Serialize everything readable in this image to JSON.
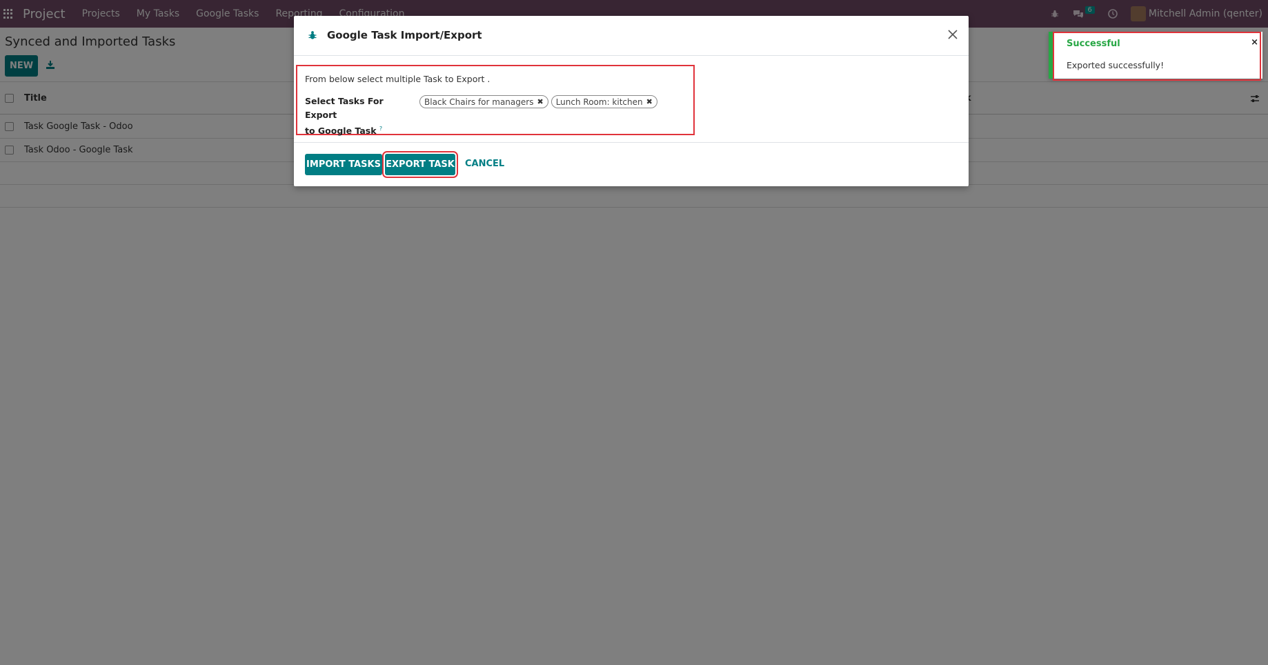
{
  "navbar": {
    "brand": "Project",
    "menu": [
      "Projects",
      "My Tasks",
      "Google Tasks",
      "Reporting",
      "Configuration"
    ],
    "chat_badge": "6",
    "user": "Mitchell Admin (qenter)"
  },
  "control_panel": {
    "title": "Synced and Imported Tasks",
    "new_label": "NEW"
  },
  "list": {
    "columns": [
      "Title",
      "k"
    ],
    "rows": [
      "Task Google Task - Odoo",
      "Task Odoo - Google Task"
    ]
  },
  "dialog": {
    "title": "Google Task Import/Export",
    "hint": "From below select multiple Task to Export .",
    "field_label_line1": "Select Tasks For Export",
    "field_label_line2": "to Google Task",
    "help_mark": "?",
    "tags": [
      "Black Chairs for managers",
      "Lunch Room: kitchen"
    ],
    "buttons": {
      "import": "IMPORT TASKS",
      "export": "EXPORT TASK",
      "cancel": "CANCEL"
    }
  },
  "toast": {
    "title": "Successful",
    "message": "Exported successfully!",
    "close": "×"
  },
  "colors": {
    "navbar": "#714b67",
    "primary": "#017e84",
    "success": "#28a745",
    "highlight": "#e0323a"
  }
}
